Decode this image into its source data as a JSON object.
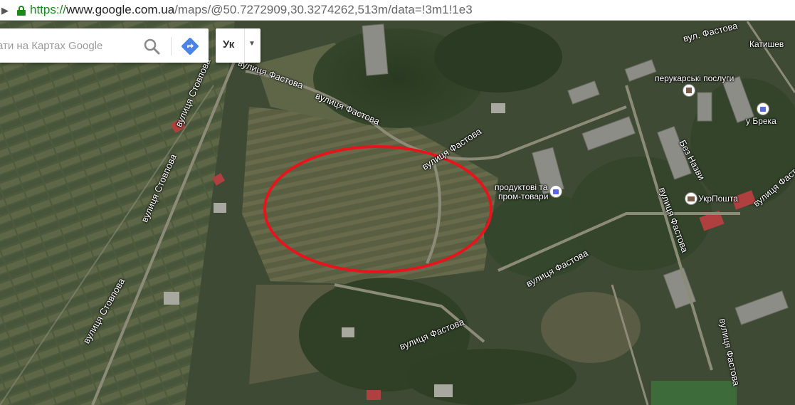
{
  "browser": {
    "url_protocol": "https://",
    "url_host": "www.google.com.ua",
    "url_rest": "/maps/@50.7272909,30.3274262,513m/data=!3m1!1e3"
  },
  "search": {
    "placeholder": "ати на Картах Google",
    "lang_label": "Ук"
  },
  "streets": [
    "вул. Фастова",
    "вулиця Фастова",
    "вулиця Фастова",
    "вулиця Фастова",
    "вулиця Фастова",
    "вулиця Фастова",
    "вулиця Фастова",
    "вулиця Стовпова",
    "вулиця Стовпова",
    "вулиця Стовпова",
    "Без Назви"
  ],
  "places": {
    "katyshev": "Катишев",
    "perukarski": "перукарські послуги",
    "brek": "у Брека",
    "produkty_line1": "продуктові та",
    "produkty_line2": "пром-товари",
    "ukrposhta": "УкрПошта"
  },
  "colors": {
    "highlight_ellipse": "#e8141c",
    "link_green": "#1a8a1a"
  }
}
